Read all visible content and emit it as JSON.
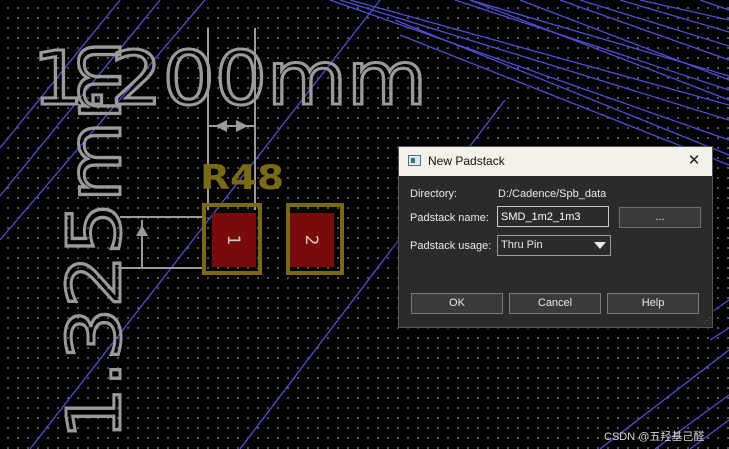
{
  "canvas": {
    "dimension_horizontal": "1.200mm",
    "dimension_vertical": "1.325mm",
    "refdes": "R48",
    "pad1": "1",
    "pad2": "2"
  },
  "colors": {
    "ratsnest": "#4f4fd6",
    "pad": "#7a0b0b",
    "silkscreen": "#7a6a12",
    "dimension": "#9a9a9a"
  },
  "dialog": {
    "title": "New Padstack",
    "close_icon": "close-icon",
    "directory_label": "Directory:",
    "directory_value": "D:/Cadence/Spb_data",
    "padstack_name_label": "Padstack name:",
    "padstack_name_value": "SMD_1m2_1m3",
    "browse_label": "...",
    "usage_label": "Padstack usage:",
    "usage_value": "Thru Pin",
    "ok_label": "OK",
    "cancel_label": "Cancel",
    "help_label": "Help"
  },
  "watermark": "CSDN @五羟基己醛"
}
